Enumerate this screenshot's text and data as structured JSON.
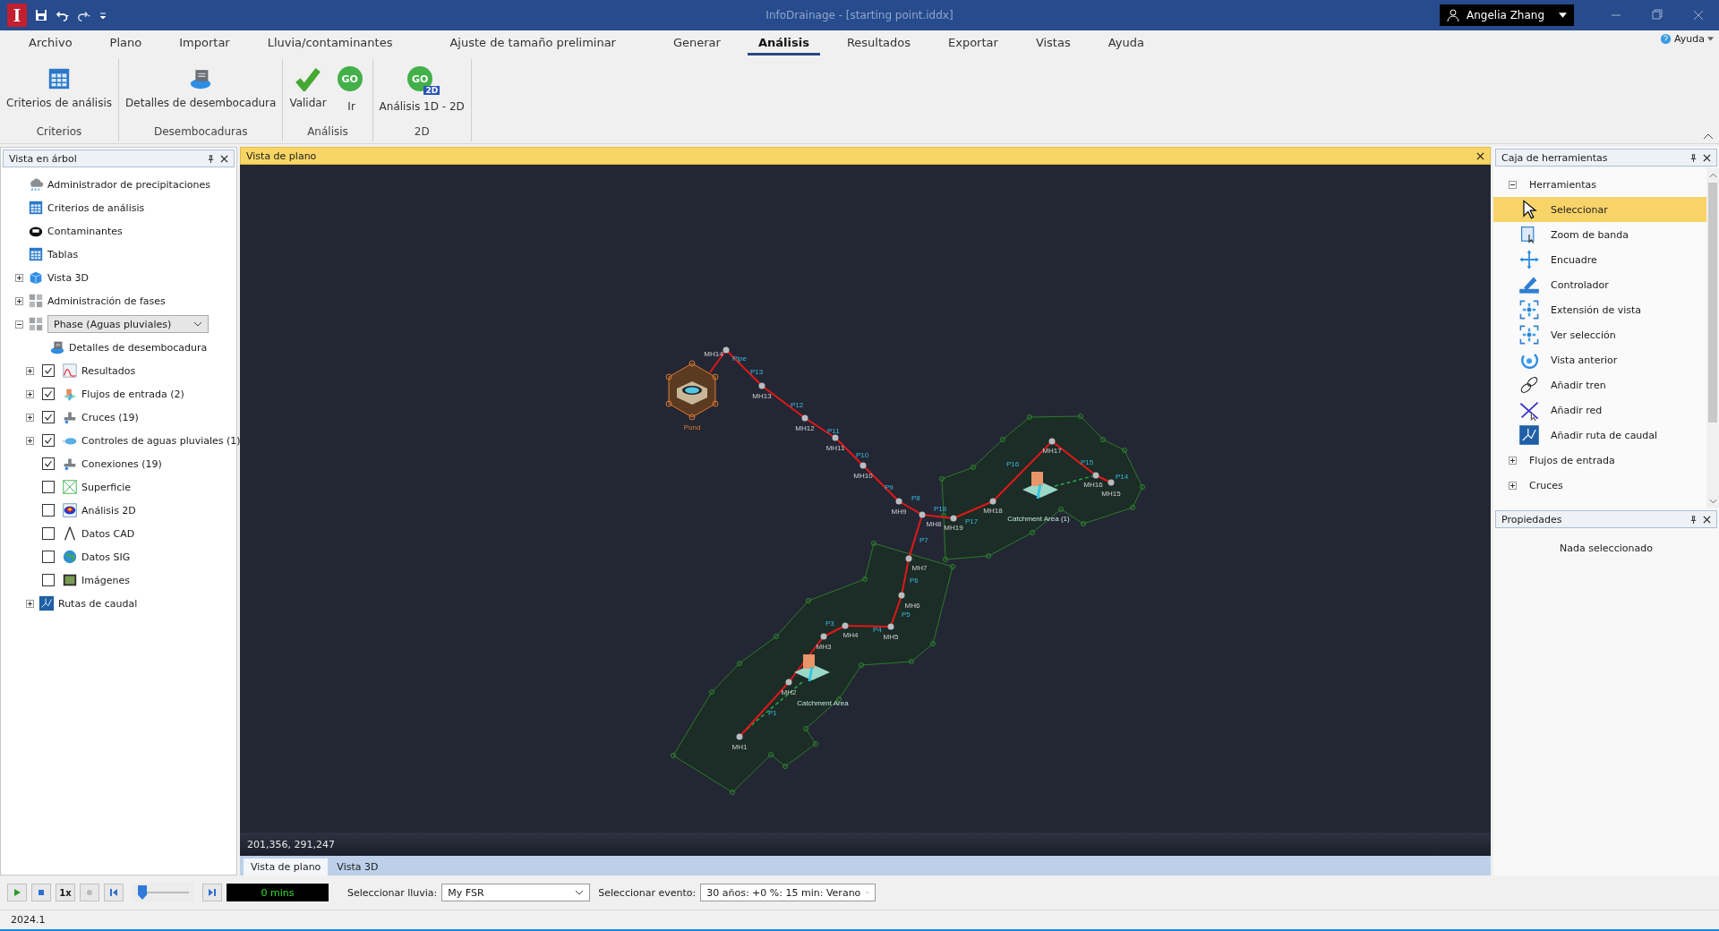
{
  "title_bar": {
    "logo": "I",
    "title": "InfoDrainage - [starting point.iddx]",
    "user": "Angelia Zhang"
  },
  "menu": [
    {
      "label": "Archivo",
      "selected": false
    },
    {
      "label": "Plano",
      "selected": false
    },
    {
      "label": "Importar",
      "selected": false
    },
    {
      "label": "Lluvia/contaminantes",
      "selected": false
    },
    {
      "label": "Ajuste de tamaño preliminar",
      "selected": false
    },
    {
      "label": "Generar",
      "selected": false
    },
    {
      "label": "Análisis",
      "selected": true
    },
    {
      "label": "Resultados",
      "selected": false
    },
    {
      "label": "Exportar",
      "selected": false
    },
    {
      "label": "Vistas",
      "selected": false
    },
    {
      "label": "Ayuda",
      "selected": false
    }
  ],
  "help_link": "Ayuda",
  "ribbon": [
    {
      "group": "Criterios",
      "buttons": [
        {
          "label": "Criterios de análisis"
        }
      ]
    },
    {
      "group": "Desembocaduras",
      "buttons": [
        {
          "label": "Detalles de desembocadura"
        }
      ]
    },
    {
      "group": "Análisis",
      "buttons": [
        {
          "label": "Validar"
        },
        {
          "label": "Ir",
          "icon_text": "GO"
        }
      ]
    },
    {
      "group": "2D",
      "buttons": [
        {
          "label": "Análisis 1D - 2D",
          "icon_text": "GO",
          "icon_badge": "2D"
        }
      ]
    }
  ],
  "tree_panel": {
    "title": "Vista en árbol",
    "items": [
      {
        "label": "Administrador de precipitaciones",
        "kind": "plain"
      },
      {
        "label": "Criterios de análisis",
        "kind": "plain"
      },
      {
        "label": "Contaminantes",
        "kind": "plain"
      },
      {
        "label": "Tablas",
        "kind": "plain"
      },
      {
        "label": "Vista 3D",
        "kind": "plain",
        "expanded": false
      },
      {
        "label": "Administración de fases",
        "kind": "plain",
        "expanded": false
      },
      {
        "label": "Phase (Aguas pluviales)",
        "kind": "dropdown",
        "expanded": true,
        "children": [
          {
            "label": "Detalles de desembocadura",
            "kind": "plain"
          },
          {
            "label": "Resultados",
            "kind": "checkbox",
            "checked": true,
            "expanded": false
          },
          {
            "label": "Flujos de entrada (2)",
            "kind": "checkbox",
            "checked": true,
            "expanded": false
          },
          {
            "label": "Cruces (19)",
            "kind": "checkbox",
            "checked": true,
            "expanded": false
          },
          {
            "label": "Controles de aguas pluviales (1)",
            "kind": "checkbox",
            "checked": true,
            "expanded": false
          },
          {
            "label": "Conexiones (19)",
            "kind": "checkbox",
            "checked": true
          },
          {
            "label": "Superficie",
            "kind": "checkbox",
            "checked": false
          },
          {
            "label": "Análisis 2D",
            "kind": "checkbox",
            "checked": false
          },
          {
            "label": "Datos CAD",
            "kind": "checkbox",
            "checked": false
          },
          {
            "label": "Datos SIG",
            "kind": "checkbox",
            "checked": false
          },
          {
            "label": "Imágenes",
            "kind": "checkbox",
            "checked": false
          },
          {
            "label": "Rutas de caudal",
            "kind": "plain",
            "expanded": false
          }
        ]
      }
    ]
  },
  "plan_view": {
    "title": "Vista de plano",
    "coordinates": "201,356, 291,247",
    "pond": "Pond",
    "nodes": [
      "MH1",
      "MH2",
      "MH3",
      "MH4",
      "MH5",
      "MH6",
      "MH7",
      "MH8",
      "MH9",
      "MH10",
      "MH11",
      "MH12",
      "MH13",
      "MH14",
      "MH15",
      "MH16",
      "MH17",
      "MH18",
      "MH19"
    ],
    "pipes": [
      "P1",
      "P3",
      "P4",
      "P5",
      "P6",
      "P7",
      "P8",
      "P9",
      "P10",
      "P11",
      "P12",
      "P13",
      "Pipe",
      "P14",
      "P15",
      "P16",
      "P17",
      "P18"
    ],
    "catchments": [
      "Catchment Area",
      "Catchment Area (1)"
    ]
  },
  "view_tabs": [
    {
      "label": "Vista de plano",
      "selected": true
    },
    {
      "label": "Vista 3D",
      "selected": false
    }
  ],
  "toolbox": {
    "title": "Caja de herramientas",
    "groups": [
      {
        "label": "Herramientas",
        "expanded": true,
        "children": [
          {
            "label": "Seleccionar",
            "selected": true
          },
          {
            "label": "Zoom de banda",
            "selected": false
          },
          {
            "label": "Encuadre",
            "selected": false
          },
          {
            "label": "Controlador",
            "selected": false
          },
          {
            "label": "Extensión de vista",
            "selected": false
          },
          {
            "label": "Ver selección",
            "selected": false
          },
          {
            "label": "Vista anterior",
            "selected": false
          },
          {
            "label": "Añadir tren",
            "selected": false
          },
          {
            "label": "Añadir red",
            "selected": false
          },
          {
            "label": "Añadir ruta de caudal",
            "selected": false
          }
        ]
      },
      {
        "label": "Flujos de entrada",
        "expanded": false
      },
      {
        "label": "Cruces",
        "expanded": false
      }
    ]
  },
  "properties": {
    "title": "Propiedades",
    "message": "Nada seleccionado"
  },
  "playback": {
    "speed": "1x",
    "level": 0,
    "time": "0 mins",
    "rain_label": "Seleccionar lluvia:",
    "rain": "My FSR",
    "event_label": "Seleccionar evento:",
    "event": "30 años: +0 %: 15 min: Verano"
  },
  "status_bar": {
    "version": "2024.1"
  }
}
